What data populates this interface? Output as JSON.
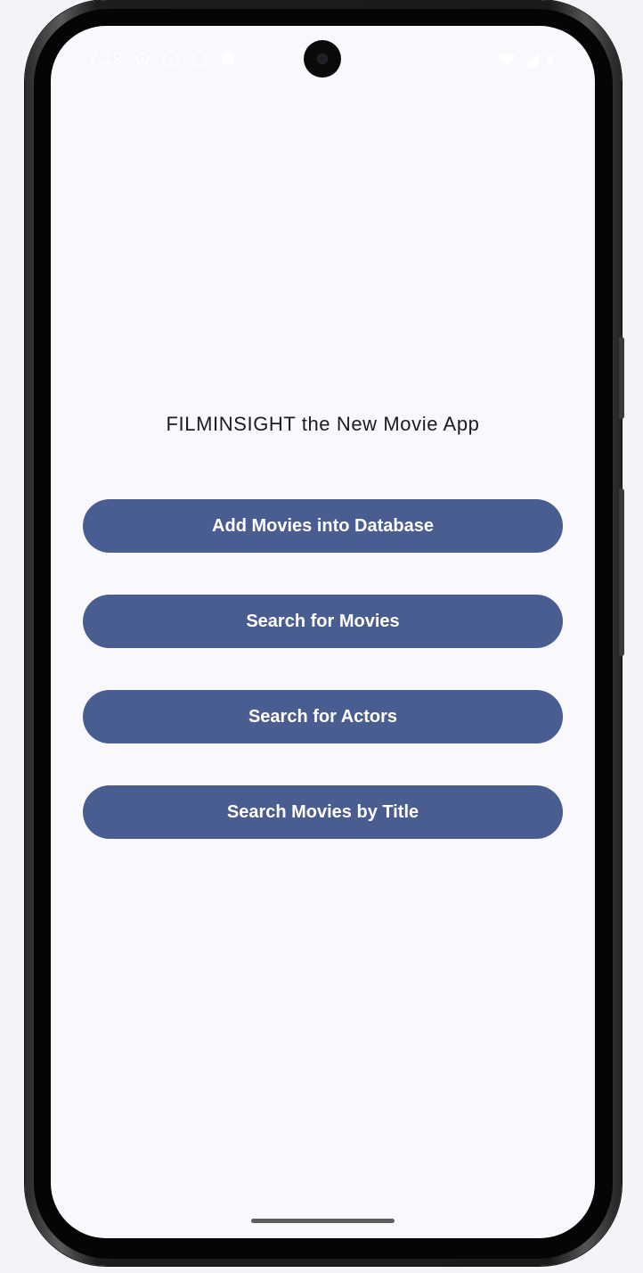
{
  "status_bar": {
    "time": "7:19",
    "left_icons": [
      "settings-gear-icon",
      "info-circle-icon",
      "shield-icon",
      "shield-filled-icon",
      "dot-icon"
    ],
    "right_icons": [
      "wifi-icon",
      "signal-icon",
      "battery-icon"
    ]
  },
  "main": {
    "app_title": "FILMINSIGHT the New Movie App",
    "buttons": [
      {
        "label": "Add Movies into Database"
      },
      {
        "label": "Search for Movies"
      },
      {
        "label": "Search for Actors"
      },
      {
        "label": "Search Movies by Title"
      }
    ]
  },
  "colors": {
    "button_bg": "#4a5d91",
    "button_text": "#ffffff",
    "screen_bg": "#f8f8fd",
    "title_text": "#1b1b22"
  }
}
